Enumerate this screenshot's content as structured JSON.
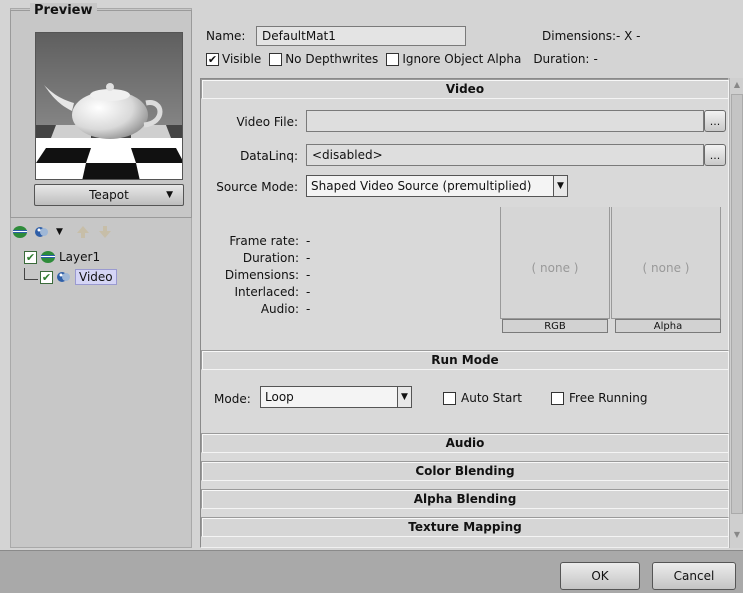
{
  "preview": {
    "legend": "Preview",
    "object_select": "Teapot"
  },
  "layers": {
    "items": [
      {
        "label": "Layer1",
        "checked": true
      },
      {
        "label": "Video",
        "checked": true
      }
    ]
  },
  "header": {
    "name_label": "Name:",
    "name_value": "DefaultMat1",
    "dimensions_label": "Dimensions:",
    "dimensions_value": "- X -",
    "visible_label": "Visible",
    "no_depthwrites_label": "No Depthwrites",
    "ignore_alpha_label": "Ignore Object Alpha",
    "duration_label": "Duration:",
    "duration_value": "-"
  },
  "video": {
    "section_title": "Video",
    "video_file_label": "Video File:",
    "video_file_value": "",
    "dataling_label": "DataLinq:",
    "dataling_value": "<disabled>",
    "source_mode_label": "Source Mode:",
    "source_mode_value": "Shaped Video Source (premultiplied)",
    "browse_label": "...",
    "info": [
      {
        "label": "Frame rate:",
        "value": "-"
      },
      {
        "label": "Duration:",
        "value": "-"
      },
      {
        "label": "Dimensions:",
        "value": "-"
      },
      {
        "label": "Interlaced:",
        "value": "-"
      },
      {
        "label": "Audio:",
        "value": "-"
      }
    ],
    "rgb_preview_text": "( none )",
    "alpha_preview_text": "( none )",
    "rgb_caption": "RGB",
    "alpha_caption": "Alpha"
  },
  "run_mode": {
    "section_title": "Run Mode",
    "mode_label": "Mode:",
    "mode_value": "Loop",
    "auto_start_label": "Auto Start",
    "free_running_label": "Free Running"
  },
  "collapsed_sections": [
    "Audio",
    "Color Blending",
    "Alpha Blending",
    "Texture Mapping"
  ],
  "buttons": {
    "ok_label": "OK",
    "cancel_label": "Cancel"
  },
  "colors": {
    "panel_bg": "#d4d4d4",
    "bottom_bar": "#a9a9a9",
    "layer_icon_green": "#2e8b3a",
    "layer_icon_blue": "#2f5fa8",
    "selection_bg": "#d5d5f5"
  }
}
